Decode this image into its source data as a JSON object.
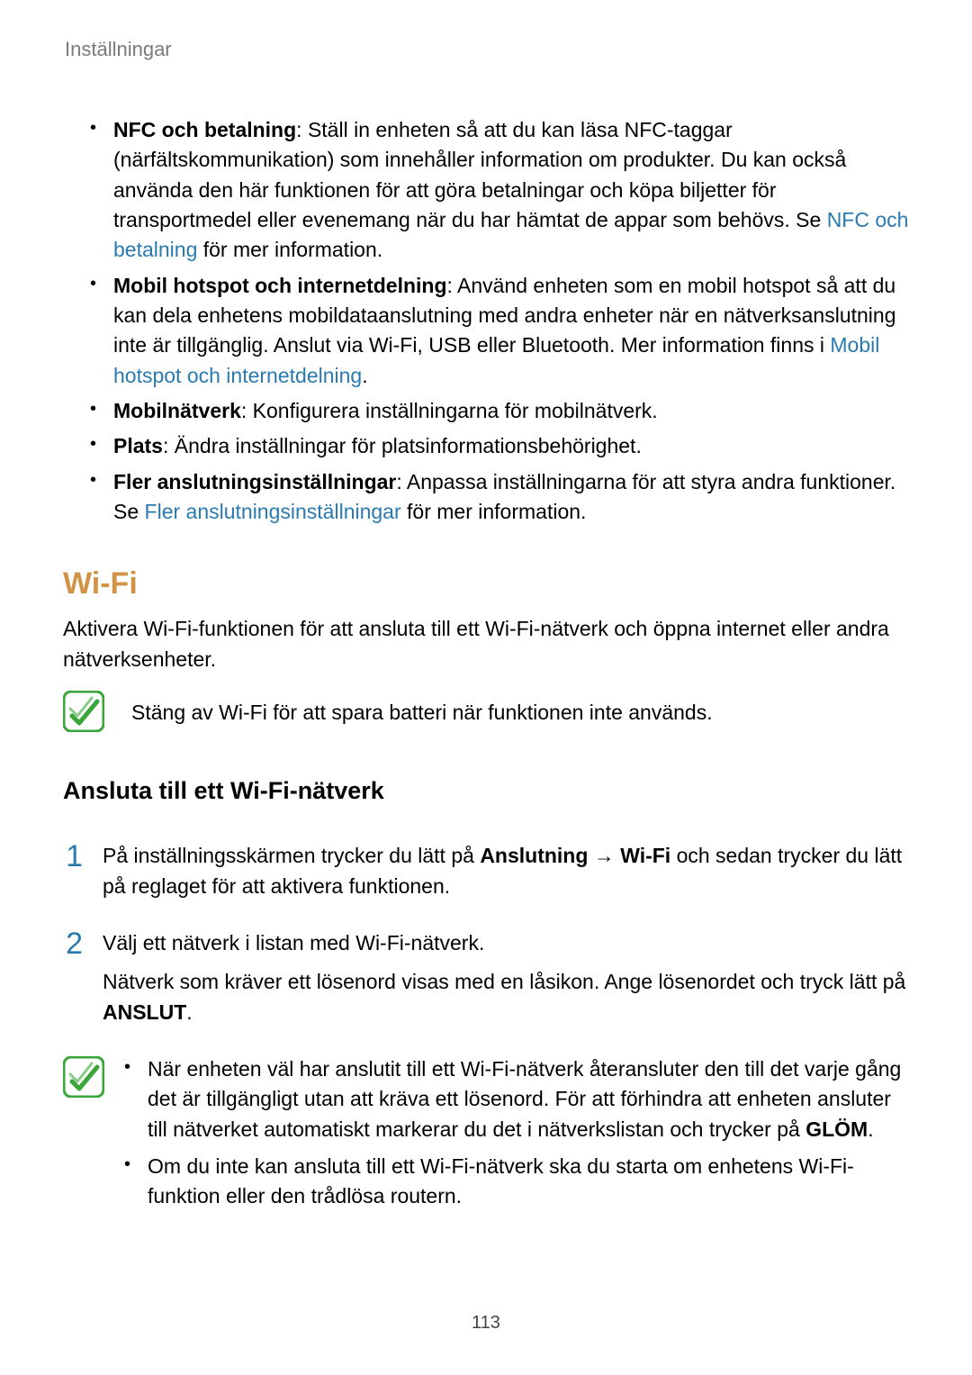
{
  "header": "Inställningar",
  "bullets": {
    "b0_bold": "NFC och betalning",
    "b0_t1": ": Ställ in enheten så att du kan läsa NFC-taggar (närfältskommunikation) som innehåller information om produkter. Du kan också använda den här funktionen för att göra betalningar och köpa biljetter för transportmedel eller evenemang när du har hämtat de appar som behövs. Se ",
    "b0_link": "NFC och betalning",
    "b0_t2": " för mer information.",
    "b1_bold": "Mobil hotspot och internetdelning",
    "b1_t1": ": Använd enheten som en mobil hotspot så att du kan dela enhetens mobildataanslutning med andra enheter när en nätverksanslutning inte är tillgänglig. Anslut via Wi-Fi, USB eller Bluetooth. Mer information finns i ",
    "b1_link": "Mobil hotspot och internetdelning",
    "b1_t2": ".",
    "b2_bold": "Mobilnätverk",
    "b2_t1": ": Konfigurera inställningarna för mobilnätverk.",
    "b3_bold": "Plats",
    "b3_t1": ": Ändra inställningar för platsinformationsbehörighet.",
    "b4_bold": "Fler anslutningsinställningar",
    "b4_t1": ": Anpassa inställningarna för att styra andra funktioner. Se ",
    "b4_link": "Fler anslutningsinställningar",
    "b4_t2": " för mer information."
  },
  "wifi": {
    "heading": "Wi-Fi",
    "intro": "Aktivera Wi-Fi-funktionen för att ansluta till ett Wi-Fi-nätverk och öppna internet eller andra nätverksenheter.",
    "note1": "Stäng av Wi-Fi för att spara batteri när funktionen inte används.",
    "subheading": "Ansluta till ett Wi-Fi-nätverk",
    "step1_a": "På inställningsskärmen trycker du lätt på ",
    "step1_b": "Anslutning",
    "step1_arrow": " → ",
    "step1_c": "Wi-Fi",
    "step1_d": " och sedan trycker du lätt på reglaget för att aktivera funktionen.",
    "step2_a": "Välj ett nätverk i listan med Wi-Fi-nätverk.",
    "step2_b1": "Nätverk som kräver ett lösenord visas med en låsikon. Ange lösenordet och tryck lätt på ",
    "step2_b2": "ANSLUT",
    "step2_b3": ".",
    "note2_li1_a": "När enheten väl har anslutit till ett Wi-Fi-nätverk återansluter den till det varje gång det är tillgängligt utan att kräva ett lösenord. För att förhindra att enheten ansluter till nätverket automatiskt markerar du det i nätverkslistan och trycker på ",
    "note2_li1_b": "GLÖM",
    "note2_li1_c": ".",
    "note2_li2": "Om du inte kan ansluta till ett Wi-Fi-nätverk ska du starta om enhetens Wi-Fi-funktion eller den trådlösa routern."
  },
  "numbers": {
    "one": "1",
    "two": "2"
  },
  "pageNumber": "113"
}
